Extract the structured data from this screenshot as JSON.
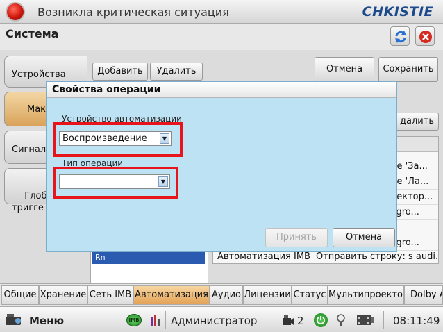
{
  "alert": {
    "title": "Возникла критическая ситуация"
  },
  "brand": {
    "logo_text": "CHKISTIE"
  },
  "section": {
    "title": "Система"
  },
  "side_tabs": [
    {
      "label": "Устройства"
    },
    {
      "label": "Макр"
    },
    {
      "label": "Сигналы"
    },
    {
      "label": "Глобал\nтригге"
    }
  ],
  "toolbar": {
    "add_label": "Добавить",
    "delete_label": "Удалить",
    "cancel_label": "Отмена",
    "save_label": "Сохранить",
    "delete2_label": "далить"
  },
  "left_panel": {
    "selected_item": "Rn"
  },
  "right_list": {
    "rows": [
      {
        "c1": "",
        "c2": "ие 'За..."
      },
      {
        "c1": "",
        "c2": "ие 'Ла..."
      },
      {
        "c1": "",
        "c2": "ректор..."
      },
      {
        "c1": "",
        "c2": "ка: s trgro..."
      },
      {
        "c1": "",
        "c2": "ка: s trgro..."
      },
      {
        "c1": "Автоматизация IMB",
        "c2": "Отправить строку: s audi..."
      }
    ]
  },
  "dialog": {
    "title": "Свойства операции",
    "device_label": "Устройство автоматизации",
    "device_value": "Воспроизведение",
    "operation_label": "Тип операции",
    "operation_value": "",
    "accept_label": "Принять",
    "cancel_label": "Отмена"
  },
  "bottom_tabs": [
    {
      "label": "Общие"
    },
    {
      "label": "Хранение"
    },
    {
      "label": "Сеть IMB"
    },
    {
      "label": "Автоматизация"
    },
    {
      "label": "Аудио"
    },
    {
      "label": "Лицензии"
    },
    {
      "label": "Статус"
    },
    {
      "label": "Мультипроектор"
    },
    {
      "label": "Dolby At"
    }
  ],
  "statusbar": {
    "menu_label": "Меню",
    "imb_badge": "IMB",
    "user": "Администратор",
    "count": "2",
    "time": "08:11:49"
  },
  "colors": {
    "highlight": "#e8141c",
    "dialog_bg": "#bde2f3",
    "active_tab": "#e3a257",
    "brand_blue": "#1c4a8c"
  }
}
